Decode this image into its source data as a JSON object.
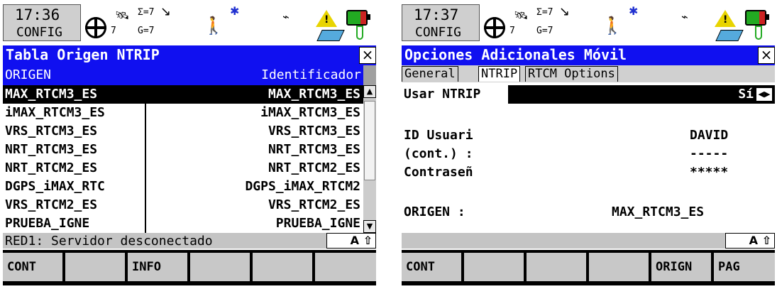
{
  "screen1": {
    "clock": {
      "time": "17:36",
      "mode": "CONFIG"
    },
    "status": {
      "sat_sum": "Σ=7",
      "sat_visible": "7",
      "sat_g": "G=7"
    },
    "title": "Tabla Origen NTRIP",
    "close_label": "×",
    "table": {
      "headers": [
        "ORIGEN",
        "Identificador"
      ],
      "rows": [
        [
          "MAX_RTCM3_ES",
          "MAX_RTCM3_ES"
        ],
        [
          "iMAX_RTCM3_ES",
          "iMAX_RTCM3_ES"
        ],
        [
          "VRS_RTCM3_ES",
          "VRS_RTCM3_ES"
        ],
        [
          "NRT_RTCM3_ES",
          "NRT_RTCM3_ES"
        ],
        [
          "NRT_RTCM2_ES",
          "NRT_RTCM2_ES"
        ],
        [
          "DGPS_iMAX_RTC",
          "DGPS_iMAX_RTCM2"
        ],
        [
          "VRS_RTCM2_ES",
          "VRS_RTCM2_ES"
        ],
        [
          "PRUEBA_IGNE",
          "PRUEBA_IGNE"
        ]
      ],
      "selected_row": 0
    },
    "message": "RED1: Servidor desconectado",
    "keyboard_mode": "A ⇧",
    "softkeys": [
      "CONT",
      "",
      "INFO",
      "",
      "",
      ""
    ]
  },
  "screen2": {
    "clock": {
      "time": "17:37",
      "mode": "CONFIG"
    },
    "status": {
      "sat_sum": "Σ=7",
      "sat_visible": "7",
      "sat_g": "G=7"
    },
    "title": "Opciones Adicionales Móvil",
    "close_label": "×",
    "tabs": [
      "General",
      "NTRIP",
      "RTCM Options"
    ],
    "active_tab": "NTRIP",
    "fields": {
      "usar_ntrip": {
        "label": "Usar NTRIP",
        "value": "Sí"
      },
      "id_usuario": {
        "label": "ID Usuari",
        "value": "DAVID"
      },
      "cont": {
        "label": "(cont.) :",
        "value": "-----"
      },
      "contrasena": {
        "label": "Contraseñ",
        "value": "*****"
      },
      "origen": {
        "label": "ORIGEN   :",
        "value": "MAX_RTCM3_ES"
      }
    },
    "message": "",
    "keyboard_mode": "A ⇧",
    "softkeys": [
      "CONT",
      "",
      "",
      "",
      "ORIGN",
      "PAG"
    ]
  },
  "icons": {
    "position": "crosshair-icon",
    "satellite": "satellite-icon",
    "radio": "radio-link-icon",
    "walker": "walking-person-icon",
    "bluetooth": "bluetooth-icon",
    "antenna": "antenna-icon",
    "warning": "warning-icon",
    "memory": "memory-card-icon",
    "battery": "battery-icon",
    "power": "power-plug-icon"
  },
  "colors": {
    "title_bar": "#1010f0",
    "selection": "#000000",
    "softkey": "#c8c8c8"
  }
}
